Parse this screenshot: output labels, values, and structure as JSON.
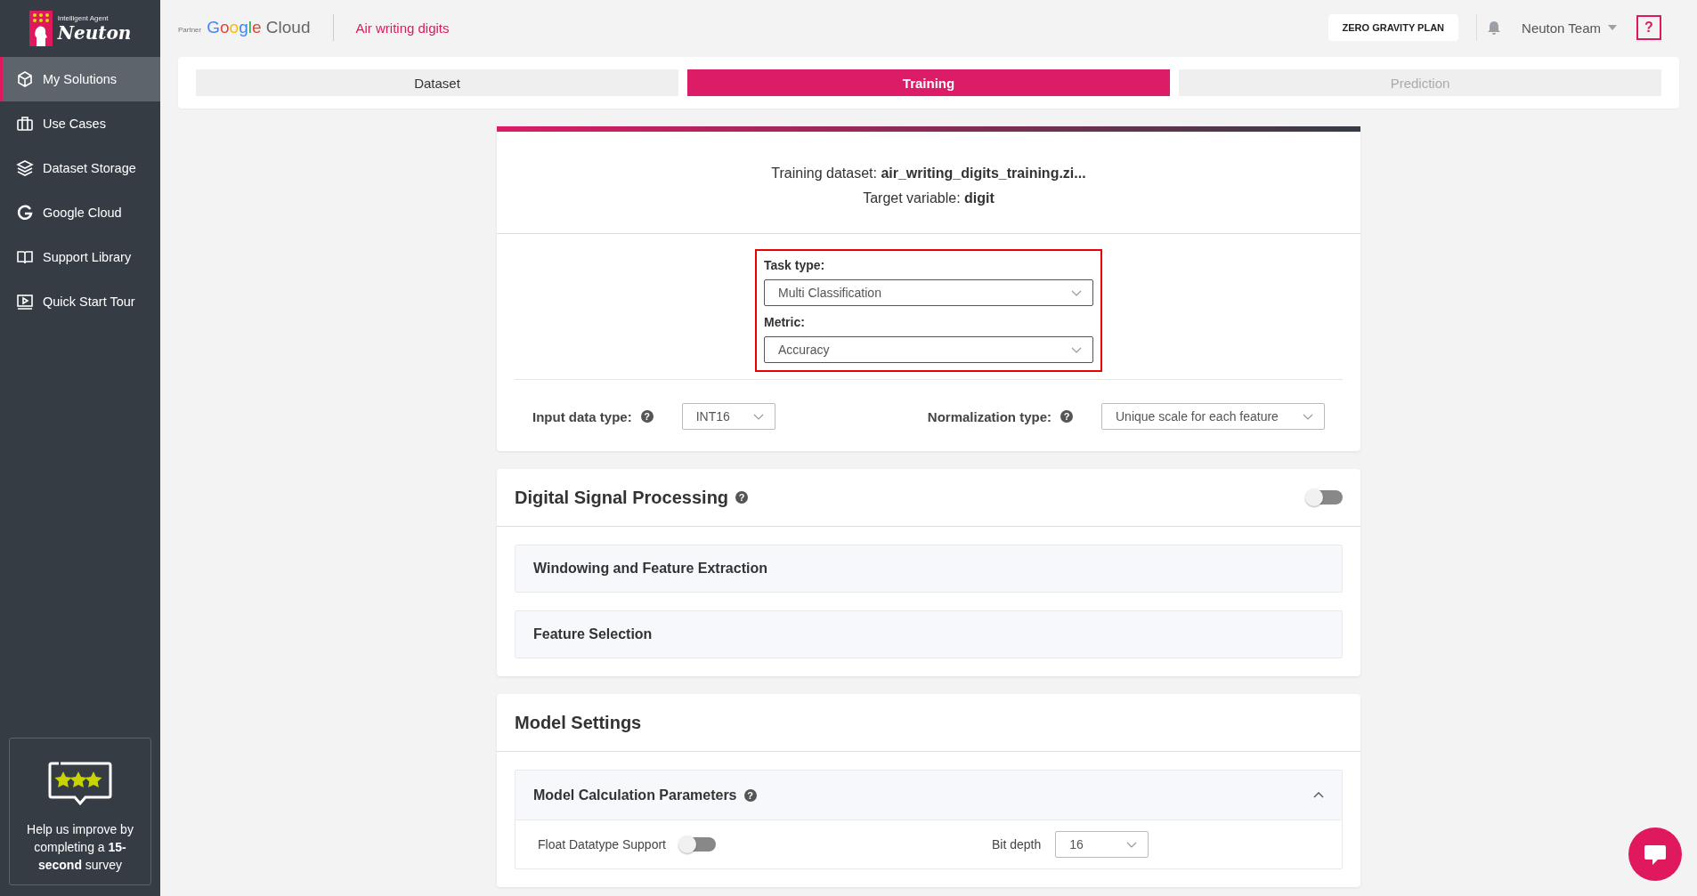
{
  "logo": {
    "tagline": "Intelligent Agent",
    "name": "Neuton"
  },
  "sidebar": {
    "items": [
      {
        "label": "My Solutions",
        "selected": true
      },
      {
        "label": "Use Cases",
        "selected": false
      },
      {
        "label": "Dataset Storage",
        "selected": false
      },
      {
        "label": "Google Cloud",
        "selected": false
      },
      {
        "label": "Support Library",
        "selected": false
      },
      {
        "label": "Quick Start Tour",
        "selected": false
      }
    ],
    "survey": {
      "text": "Help us improve by completing a **15-second** survey"
    }
  },
  "header": {
    "partner": "Partner",
    "partner_brand": [
      "G",
      "o",
      "o",
      "g",
      "l",
      "e"
    ],
    "partner_product": "Cloud",
    "solution": "Air writing digits",
    "plan": "ZERO GRAVITY PLAN",
    "user": "Neuton Team",
    "help": "?"
  },
  "tabs": [
    {
      "label": "Dataset",
      "selected": false,
      "disabled": false
    },
    {
      "label": "Training",
      "selected": true,
      "disabled": false
    },
    {
      "label": "Prediction",
      "selected": false,
      "disabled": true
    }
  ],
  "training": {
    "dataset_label": "Training dataset:",
    "dataset": "air_writing_digits_training.zi...",
    "target_label": "Target variable:",
    "target": "digit",
    "highlight": true,
    "task_type": {
      "label": "Task type:",
      "value": "Multi Classification"
    },
    "metric": {
      "label": "Metric:",
      "value": "Accuracy"
    },
    "input_type": {
      "label": "Input data type:",
      "help": "?",
      "value": "INT16"
    },
    "normalization": {
      "label": "Normalization type:",
      "help": "?",
      "value": "Unique scale for each feature"
    }
  },
  "dsp": {
    "title": "Digital Signal Processing",
    "help": "?",
    "on": false,
    "sections": [
      "Windowing and Feature Extraction",
      "Feature Selection"
    ]
  },
  "model_settings": {
    "title": "Model Settings",
    "section": {
      "title": "Model Calculation Parameters",
      "help": "?",
      "expanded": true,
      "float_support": {
        "label": "Float Datatype Support",
        "on": false
      },
      "bit_depth": {
        "label": "Bit depth",
        "value": "16"
      }
    }
  }
}
